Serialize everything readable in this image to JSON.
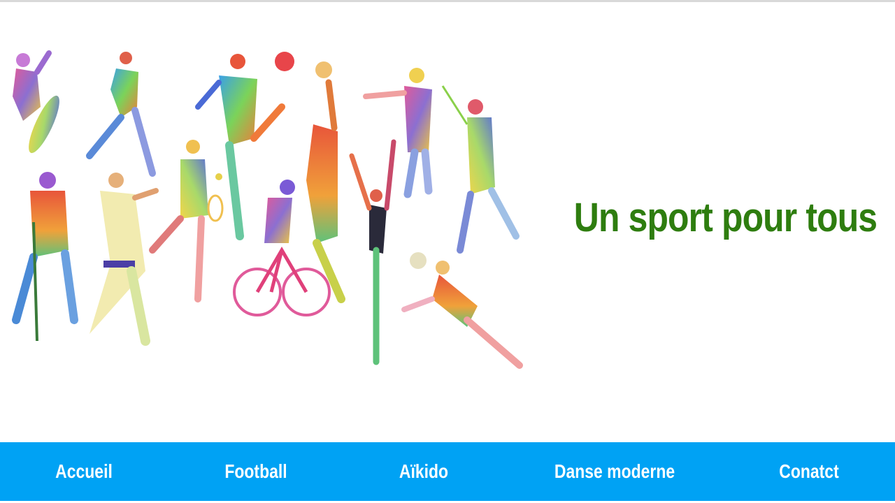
{
  "hero": {
    "title": "Un sport pour tous",
    "image_alt": "sports illustration",
    "title_color": "#2e7d0f"
  },
  "nav": {
    "background": "#00a2f4",
    "items": [
      {
        "label": "Accueil"
      },
      {
        "label": "Football"
      },
      {
        "label": "Aïkido"
      },
      {
        "label": "Danse moderne"
      },
      {
        "label": "Conatct"
      }
    ]
  }
}
